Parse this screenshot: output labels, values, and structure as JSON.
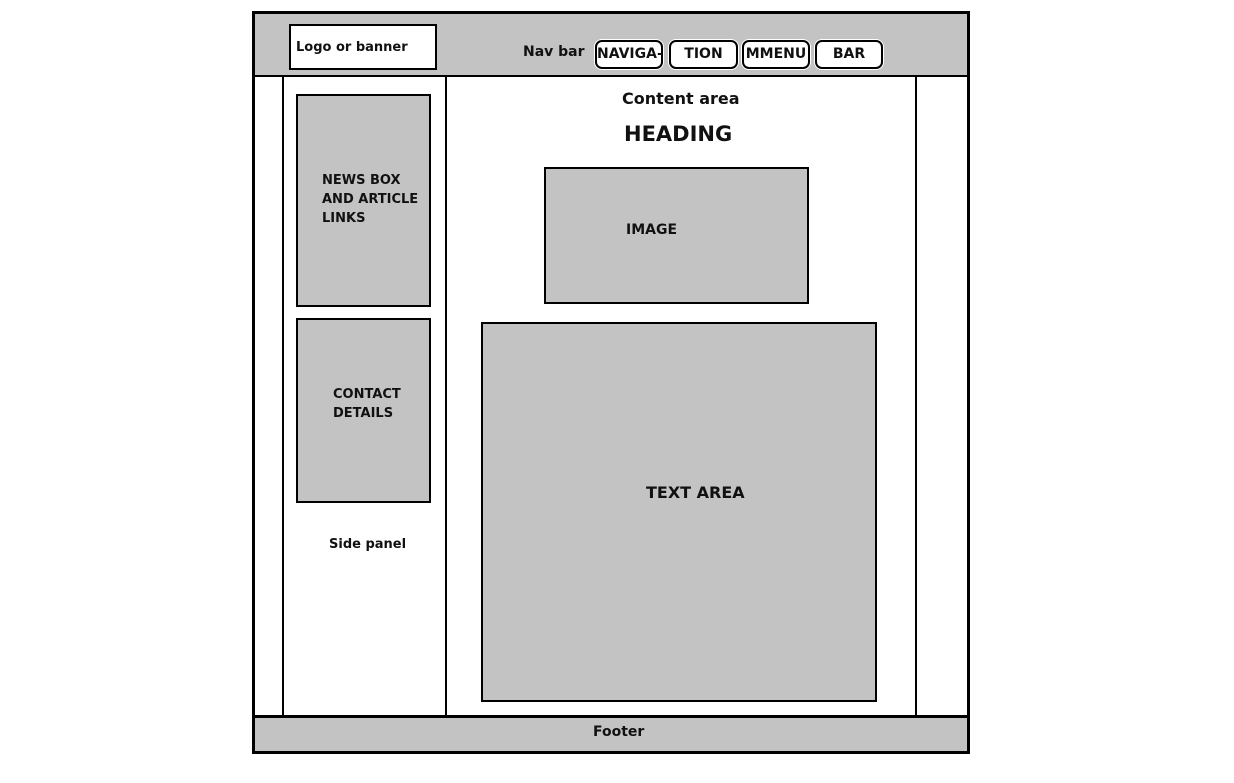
{
  "header": {
    "logo_label": "Logo or banner",
    "nav_label": "Nav bar",
    "nav_buttons": [
      "NAVIGA-",
      "TION",
      "MMENU",
      "BAR"
    ]
  },
  "side_panel": {
    "news_box": [
      "NEWS BOX",
      "AND ARTICLE",
      "LINKS"
    ],
    "contact_box": [
      "CONTACT",
      "DETAILS"
    ],
    "label": "Side panel"
  },
  "content": {
    "label": "Content area",
    "heading": "HEADING",
    "image_label": "IMAGE",
    "text_area_label": "TEXT AREA"
  },
  "footer": {
    "label": "Footer"
  },
  "colors": {
    "gray_fill": "#c3c3c3",
    "outline": "#000000",
    "background": "#ffffff"
  }
}
